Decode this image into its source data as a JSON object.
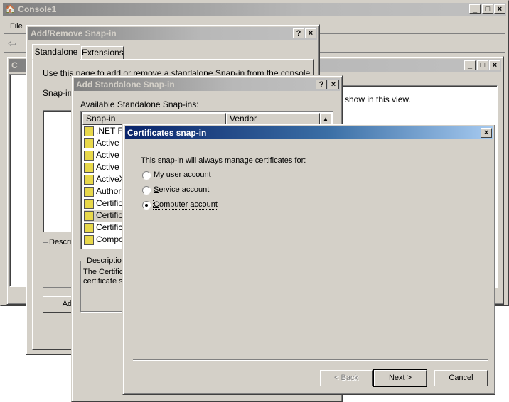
{
  "console": {
    "title": "Console1",
    "menu": [
      "File"
    ],
    "child_title": "C",
    "child_text": "show in this view."
  },
  "addremove": {
    "title": "Add/Remove Snap-in",
    "tabs": [
      "Standalone",
      "Extensions"
    ],
    "intro": "Use this page to add or remove a standalone Snap-in from the console.",
    "snapins_label": "Snap-ins",
    "description_label": "Descri",
    "add_button": "Add"
  },
  "standalone": {
    "title": "Add Standalone Snap-in",
    "available_label": "Available Standalone Snap-ins:",
    "columns": [
      "Snap-in",
      "Vendor"
    ],
    "items": [
      ".NET Fr",
      "Active D",
      "Active D",
      "Active D",
      "ActiveX",
      "Authoriz",
      "Certifica",
      "Certifica",
      "Certifica",
      "Compon"
    ],
    "selected_index": 7,
    "description_label": "Description",
    "description_text": [
      "The Certifica",
      "certificate st"
    ]
  },
  "certs": {
    "title": "Certificates snap-in",
    "prompt": "This snap-in will always manage certificates for:",
    "options": [
      {
        "label": "My user account",
        "key": "M",
        "rest": "y user account"
      },
      {
        "label": "Service account",
        "key": "S",
        "rest": "ervice account"
      },
      {
        "label": "Computer account",
        "key": "C",
        "rest": "omputer account"
      }
    ],
    "selected": "Computer account",
    "back": "< Back",
    "next": "Next >",
    "cancel": "Cancel",
    "accent": "#0a246a"
  }
}
